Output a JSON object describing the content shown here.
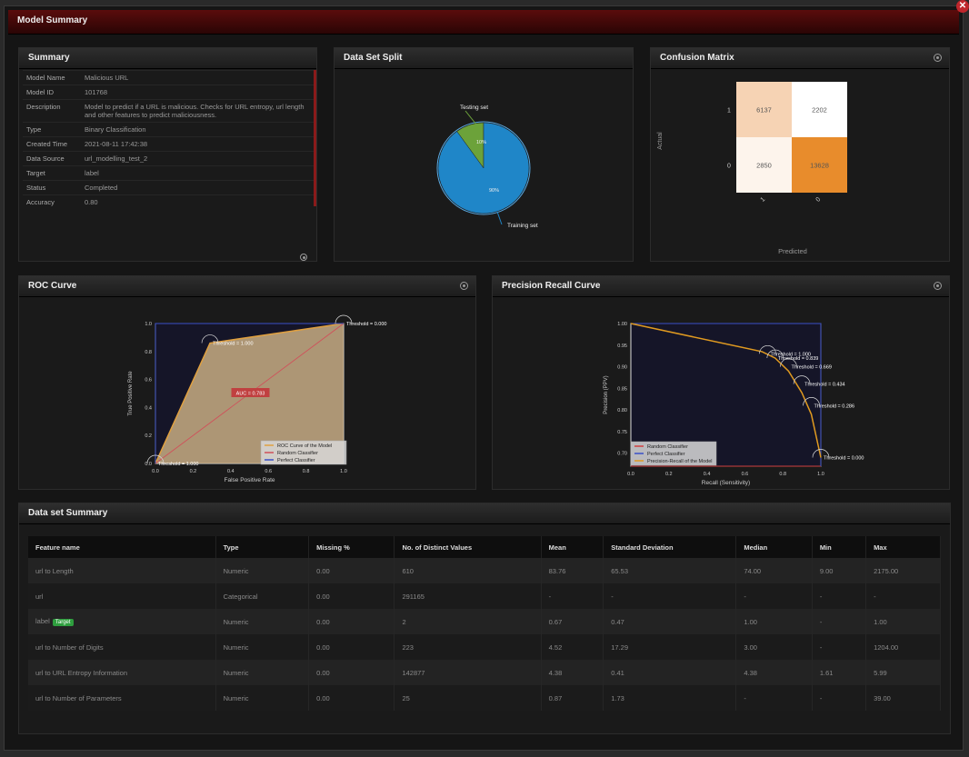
{
  "window": {
    "title": "Model Summary"
  },
  "summary": {
    "title": "Summary",
    "rows": [
      {
        "key": "Model Name",
        "value": "Malicious URL"
      },
      {
        "key": "Model ID",
        "value": "101768"
      },
      {
        "key": "Description",
        "value": "Model to predict if a URL is malicious. Checks for URL entropy, url length and other features to predict maliciousness."
      },
      {
        "key": "Type",
        "value": "Binary Classification"
      },
      {
        "key": "Created Time",
        "value": "2021-08-11 17:42:38"
      },
      {
        "key": "Data Source",
        "value": "url_modelling_test_2"
      },
      {
        "key": "Target",
        "value": "label"
      },
      {
        "key": "Status",
        "value": "Completed"
      },
      {
        "key": "Accuracy",
        "value": "0.80"
      }
    ]
  },
  "split": {
    "title": "Data Set Split",
    "chart_data": {
      "type": "pie",
      "slices": [
        {
          "label": "Training set",
          "value": 90,
          "text": "90%",
          "color": "#1f86c8"
        },
        {
          "label": "Testing set",
          "value": 10,
          "text": "10%",
          "color": "#6ca23a"
        }
      ]
    }
  },
  "confusion": {
    "title": "Confusion Matrix",
    "ylabel": "Actual",
    "xlabel": "Predicted",
    "row_labels": [
      "1",
      "0"
    ],
    "col_labels": [
      "1",
      "0"
    ],
    "cells": [
      [
        {
          "value": "6137",
          "color": "#f6d3b4"
        },
        {
          "value": "2202",
          "color": "#ffffff"
        }
      ],
      [
        {
          "value": "2850",
          "color": "#fdf4ec"
        },
        {
          "value": "13628",
          "color": "#e88c2c"
        }
      ]
    ]
  },
  "roc": {
    "title": "ROC Curve",
    "chart_data": {
      "type": "line",
      "xlabel": "False Positive Rate",
      "ylabel": "True Positive Rate",
      "xlim": [
        0,
        1
      ],
      "ylim": [
        0,
        1
      ],
      "ticks": [
        "0.0",
        "0.2",
        "0.4",
        "0.6",
        "0.8",
        "1.0"
      ],
      "auc_label": "AUC = 0.783",
      "series": [
        {
          "name": "ROC Curve of the Model",
          "x": [
            0,
            0.29,
            1
          ],
          "y": [
            0,
            0.86,
            1
          ],
          "color": "#e0a040"
        },
        {
          "name": "Random Classifier",
          "x": [
            0,
            1
          ],
          "y": [
            0,
            1
          ],
          "color": "#d0505a"
        },
        {
          "name": "Perfect Classifier",
          "x": [
            0,
            0,
            1
          ],
          "y": [
            0,
            1,
            1
          ],
          "color": "#3a50c8"
        }
      ],
      "thresholds": [
        {
          "x": 0,
          "y": 0,
          "label": "Threshold = 1.000"
        },
        {
          "x": 0.29,
          "y": 0.86,
          "label": "Threshold = 1.000"
        },
        {
          "x": 1,
          "y": 1,
          "label": "Threshold = 0.000"
        }
      ]
    }
  },
  "pr": {
    "title": "Precision Recall Curve",
    "chart_data": {
      "type": "line",
      "xlabel": "Recall (Sensitivity)",
      "ylabel": "Precision (PPV)",
      "xlim": [
        0,
        1
      ],
      "ylim": [
        0.67,
        1
      ],
      "xticks": [
        "0.0",
        "0.2",
        "0.4",
        "0.6",
        "0.8",
        "1.0"
      ],
      "yticks": [
        {
          "v": 1.0,
          "l": "1.00"
        },
        {
          "v": 0.95,
          "l": "0.95"
        },
        {
          "v": 0.9,
          "l": "0.90"
        },
        {
          "v": 0.85,
          "l": "0.85"
        },
        {
          "v": 0.8,
          "l": "0.80"
        },
        {
          "v": 0.75,
          "l": "0.75"
        },
        {
          "v": 0.7,
          "l": "0.70"
        }
      ],
      "series": [
        {
          "name": "Random Classifier",
          "x": [
            0,
            1
          ],
          "y": [
            0.67,
            0.67
          ],
          "color": "#d04040"
        },
        {
          "name": "Perfect Classifier",
          "x": [
            0,
            1,
            1
          ],
          "y": [
            1,
            1,
            0.67
          ],
          "color": "#3a50c8"
        },
        {
          "name": "Precision-Recall of the Model",
          "x": [
            0,
            0.69,
            0.76,
            0.83,
            0.9,
            0.95,
            1.0
          ],
          "y": [
            1.0,
            0.935,
            0.92,
            0.89,
            0.84,
            0.79,
            0.69
          ],
          "color": "#e09a20"
        }
      ],
      "thresholds": [
        {
          "x": 0.72,
          "y": 0.93,
          "label": "Threshold = 1.000"
        },
        {
          "x": 0.76,
          "y": 0.92,
          "label": "Threshold = 0.839"
        },
        {
          "x": 0.83,
          "y": 0.9,
          "label": "Threshold = 0.669"
        },
        {
          "x": 0.9,
          "y": 0.86,
          "label": "Threshold = 0.434"
        },
        {
          "x": 0.95,
          "y": 0.81,
          "label": "Threshold = 0.286"
        },
        {
          "x": 1.0,
          "y": 0.69,
          "label": "Threshold = 0.000"
        }
      ]
    }
  },
  "dataset": {
    "title": "Data set Summary",
    "target_badge": "Target",
    "columns": [
      "Feature name",
      "Type",
      "Missing %",
      "No. of Distinct Values",
      "Mean",
      "Standard Deviation",
      "Median",
      "Min",
      "Max"
    ],
    "rows": [
      [
        "url to Length",
        "Numeric",
        "0.00",
        "610",
        "83.76",
        "65.53",
        "74.00",
        "9.00",
        "2175.00"
      ],
      [
        "url",
        "Categorical",
        "0.00",
        "291165",
        "-",
        "-",
        "-",
        "-",
        "-"
      ],
      [
        "label",
        "Numeric",
        "0.00",
        "2",
        "0.67",
        "0.47",
        "1.00",
        "-",
        "1.00"
      ],
      [
        "url to Number of Digits",
        "Numeric",
        "0.00",
        "223",
        "4.52",
        "17.29",
        "3.00",
        "-",
        "1204.00"
      ],
      [
        "url to URL Entropy Information",
        "Numeric",
        "0.00",
        "142877",
        "4.38",
        "0.41",
        "4.38",
        "1.61",
        "5.99"
      ],
      [
        "url to Number of Parameters",
        "Numeric",
        "0.00",
        "25",
        "0.87",
        "1.73",
        "-",
        "-",
        "39.00"
      ]
    ]
  }
}
